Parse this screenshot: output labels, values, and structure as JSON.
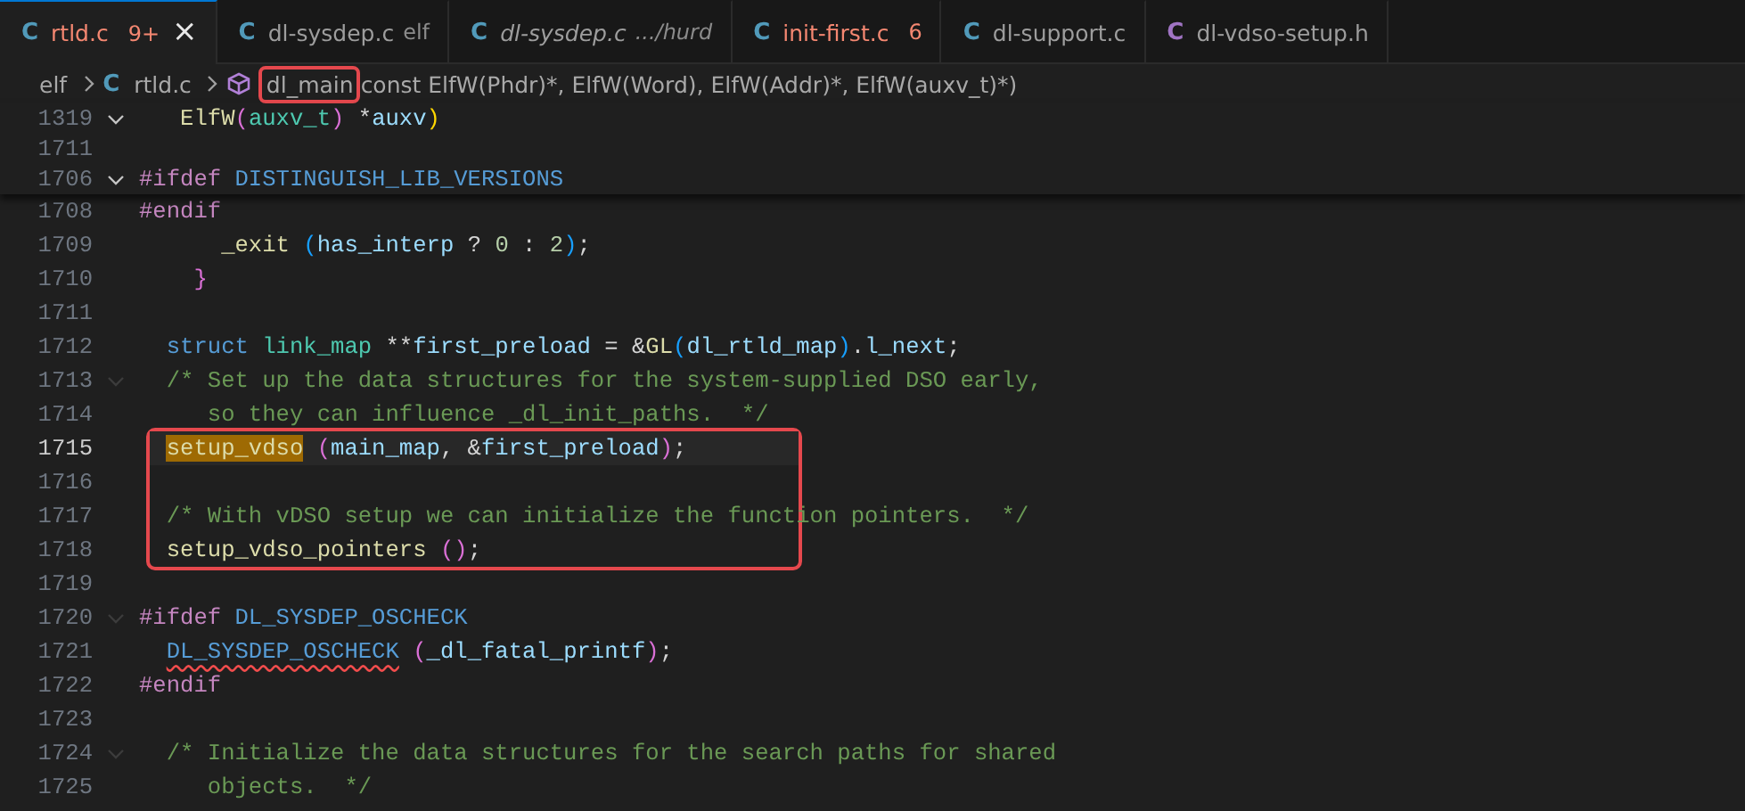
{
  "tabs": [
    {
      "icon": "C",
      "color": "#519aba",
      "label": "rtld.c",
      "badge": "9+",
      "error": true,
      "italic": false,
      "selected": true,
      "close": "×"
    },
    {
      "icon": "C",
      "color": "#519aba",
      "label": "dl-sysdep.c",
      "description": "elf",
      "error": false,
      "italic": false,
      "selected": false
    },
    {
      "icon": "C",
      "color": "#519aba",
      "label": "dl-sysdep.c",
      "description": ".../hurd",
      "error": false,
      "italic": true,
      "selected": false
    },
    {
      "icon": "C",
      "color": "#519aba",
      "label": "init-first.c",
      "badge": "6",
      "error": true,
      "italic": false,
      "selected": false
    },
    {
      "icon": "C",
      "color": "#519aba",
      "label": "dl-support.c",
      "error": false,
      "italic": false,
      "selected": false
    },
    {
      "icon": "C",
      "color": "#a074c4",
      "label": "dl-vdso-setup.h",
      "error": false,
      "italic": false,
      "selected": false
    }
  ],
  "breadcrumb": [
    {
      "kind": "folder",
      "label": "elf",
      "boxed": false
    },
    {
      "kind": "file",
      "icon": "C",
      "label": "rtld.c",
      "boxed": false
    },
    {
      "kind": "symbol",
      "label": "dl_main",
      "detail": "const ElfW(Phdr)*, ElfW(Word), ElfW(Addr)*, ElfW(auxv_t)*)",
      "boxed": true
    }
  ],
  "sticky_scroll": [
    {
      "number": "1319",
      "expanded": true,
      "tokens": [
        {
          "kind": "fn",
          "text": "   ElfW"
        },
        {
          "kind": "br2",
          "text": "("
        },
        {
          "kind": "ty",
          "text": "auxv_t"
        },
        {
          "kind": "br2",
          "text": ")"
        },
        {
          "kind": "op",
          "text": " *"
        },
        {
          "kind": "var",
          "text": "auxv"
        },
        {
          "kind": "br1",
          "text": ")"
        }
      ]
    },
    {
      "number": "1711"
    },
    {
      "number": "1706",
      "expanded": true,
      "tokens": [
        {
          "kind": "pp",
          "text": "#ifdef"
        },
        {
          "kind": "mac",
          "text": " DISTINGUISH_LIB_VERSIONS"
        }
      ]
    }
  ],
  "code_groups": [
    {
      "outlined": false,
      "lines": [
        {
          "number": "1708",
          "current": false,
          "tokens": [
            {
              "kind": "pp",
              "text": "#endif"
            }
          ]
        },
        {
          "number": "1709",
          "current": false,
          "tokens": [
            {
              "kind": "fn",
              "text": "      _exit"
            },
            {
              "kind": "br3",
              "text": " ("
            },
            {
              "kind": "var",
              "text": "has_interp"
            },
            {
              "kind": "op",
              "text": " ? "
            },
            {
              "kind": "num",
              "text": "0"
            },
            {
              "kind": "op",
              "text": " : "
            },
            {
              "kind": "num",
              "text": "2"
            },
            {
              "kind": "br3",
              "text": ")"
            },
            {
              "kind": "op",
              "text": ";"
            }
          ]
        },
        {
          "number": "1710",
          "current": false,
          "tokens": [
            {
              "kind": "br2",
              "text": "    }"
            }
          ]
        },
        {
          "number": "1711",
          "current": false
        },
        {
          "number": "1712",
          "current": false,
          "tokens": [
            {
              "kind": "kw",
              "text": "  struct"
            },
            {
              "kind": "ty",
              "text": " link_map"
            },
            {
              "kind": "op",
              "text": " **"
            },
            {
              "kind": "var",
              "text": "first_preload"
            },
            {
              "kind": "op",
              "text": " = &"
            },
            {
              "kind": "fn",
              "text": "GL"
            },
            {
              "kind": "br3",
              "text": "("
            },
            {
              "kind": "var",
              "text": "dl_rtld_map"
            },
            {
              "kind": "br3",
              "text": ")"
            },
            {
              "kind": "op",
              "text": "."
            },
            {
              "kind": "var",
              "text": "l_next"
            },
            {
              "kind": "op",
              "text": ";"
            }
          ]
        },
        {
          "number": "1713",
          "current": false,
          "fold_hint": true,
          "tokens": [
            {
              "kind": "com",
              "text": "  /* Set up the data structures for the system-supplied DSO early,"
            }
          ]
        },
        {
          "number": "1714",
          "current": false,
          "tokens": [
            {
              "kind": "com",
              "text": "     so they can influence _dl_init_paths.  */"
            }
          ]
        }
      ]
    },
    {
      "outlined": true,
      "lines": [
        {
          "number": "1715",
          "current": true,
          "tokens": [
            {
              "kind": "fn",
              "text": "  setup_vdso",
              "match": true
            },
            {
              "kind": "br2",
              "text": " ("
            },
            {
              "kind": "var",
              "text": "main_map"
            },
            {
              "kind": "op",
              "text": ", &"
            },
            {
              "kind": "var",
              "text": "first_preload"
            },
            {
              "kind": "br2",
              "text": ")"
            },
            {
              "kind": "op",
              "text": ";"
            }
          ]
        },
        {
          "number": "1716",
          "current": false
        },
        {
          "number": "1717",
          "current": false,
          "tokens": [
            {
              "kind": "com",
              "text": "  /* With vDSO setup we can initialize the function pointers.  */"
            }
          ]
        },
        {
          "number": "1718",
          "current": false,
          "tokens": [
            {
              "kind": "fn",
              "text": "  setup_vdso_pointers"
            },
            {
              "kind": "br2",
              "text": " ()"
            },
            {
              "kind": "op",
              "text": ";"
            }
          ]
        }
      ]
    },
    {
      "outlined": false,
      "lines": [
        {
          "number": "1719",
          "current": false
        },
        {
          "number": "1720",
          "current": false,
          "fold_hint": true,
          "tokens": [
            {
              "kind": "pp",
              "text": "#ifdef"
            },
            {
              "kind": "mac",
              "text": " DL_SYSDEP_OSCHECK"
            }
          ]
        },
        {
          "number": "1721",
          "current": false,
          "tokens": [
            {
              "kind": "mac",
              "text": "  DL_SYSDEP_OSCHECK",
              "squiggle": true
            },
            {
              "kind": "br2",
              "text": " ("
            },
            {
              "kind": "var",
              "text": "_dl_fatal_printf"
            },
            {
              "kind": "br2",
              "text": ")"
            },
            {
              "kind": "op",
              "text": ";"
            }
          ]
        },
        {
          "number": "1722",
          "current": false,
          "tokens": [
            {
              "kind": "pp",
              "text": "#endif"
            }
          ]
        },
        {
          "number": "1723",
          "current": false
        },
        {
          "number": "1724",
          "current": false,
          "fold_hint": true,
          "tokens": [
            {
              "kind": "com",
              "text": "  /* Initialize the data structures for the search paths for shared"
            }
          ]
        },
        {
          "number": "1725",
          "current": false,
          "tokens": [
            {
              "kind": "com",
              "text": "     objects.  */"
            }
          ]
        }
      ]
    }
  ]
}
